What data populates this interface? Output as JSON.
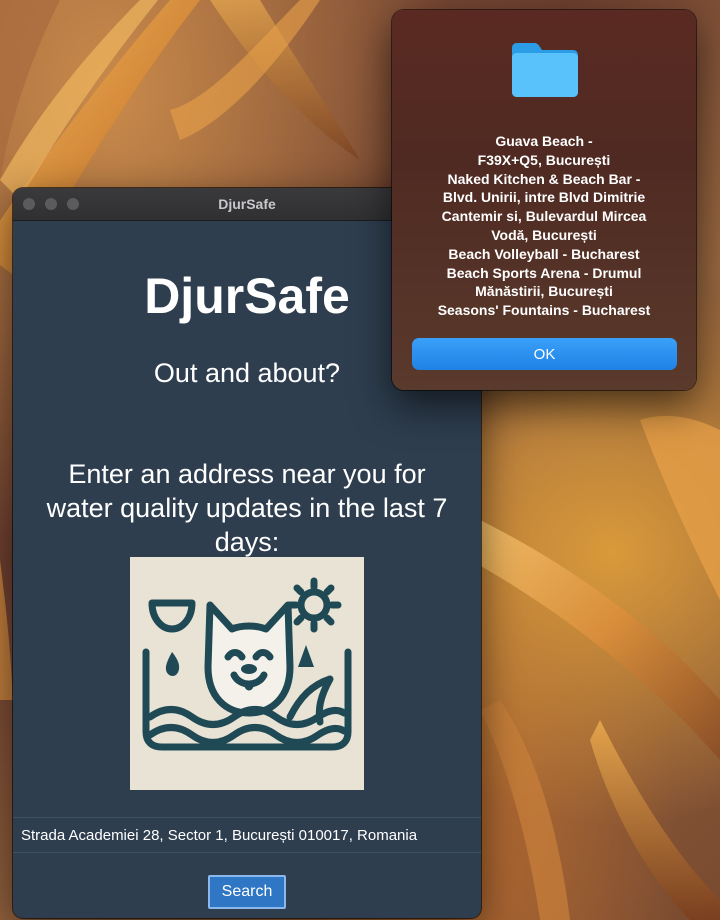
{
  "window": {
    "title": "DjurSafe"
  },
  "app": {
    "heading": "DjurSafe",
    "subheading": "Out and about?",
    "instructions": "Enter an address near you for water quality updates in the last 7 days:",
    "logo_icon": "dog-in-water-logo-icon",
    "address_value": "Strada Academiei 28, Sector 1, București 010017, Romania",
    "search_label": "Search"
  },
  "alert": {
    "icon": "folder-icon",
    "message_lines": [
      "Guava Beach -",
      "F39X+Q5, București",
      "Naked Kitchen & Beach Bar -",
      "Blvd. Unirii, intre Blvd Dimitrie",
      "Cantemir si, Bulevardul Mircea",
      "Vodă, București",
      "Beach Volleyball - Bucharest",
      "Beach Sports Arena - Drumul",
      "Mănăstirii, București",
      "Seasons' Fountains - Bucharest"
    ],
    "ok_label": "OK"
  },
  "colors": {
    "app_background": "#2e3e4f",
    "accent_button": "#2f76c4",
    "alert_button": "#1f82e6",
    "logo_ink": "#1f4a55",
    "logo_background": "#e9e3d5"
  }
}
